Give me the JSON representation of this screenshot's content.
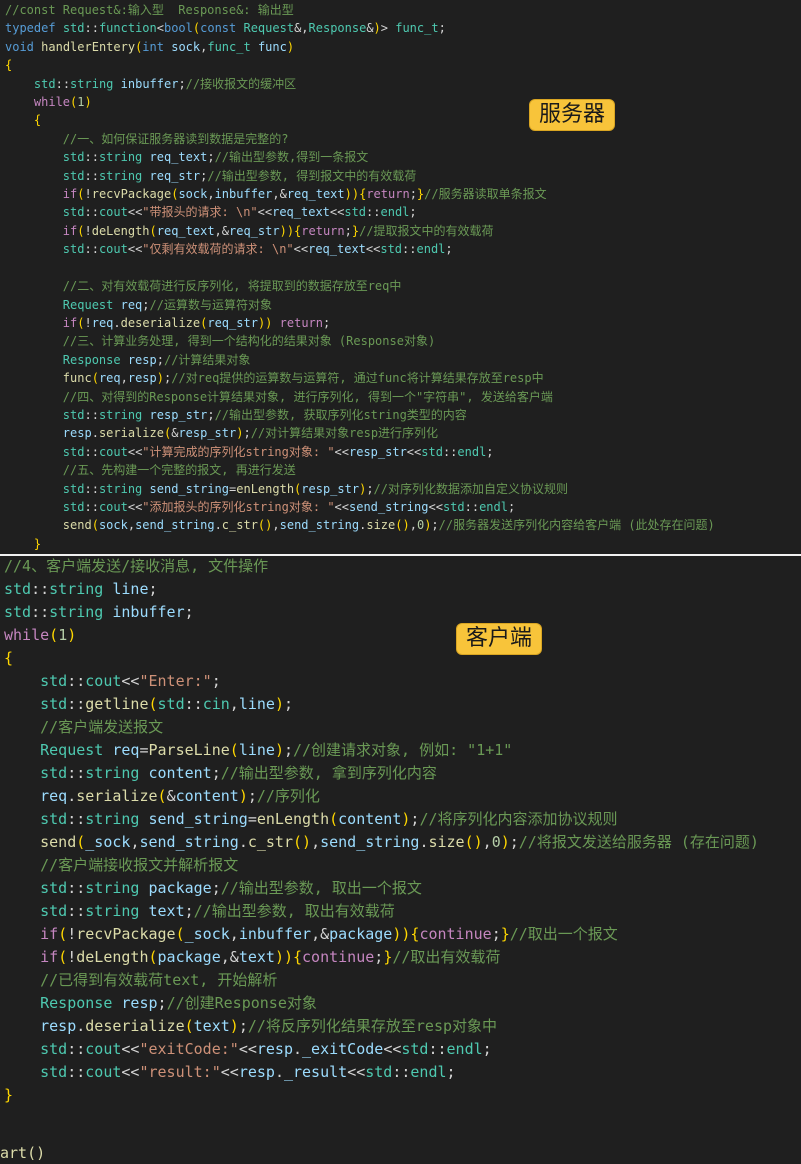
{
  "server": {
    "label": "服务器",
    "lines": [
      "//const Request&:输入型  Response&: 输出型",
      "typedef std::function<bool(const Request&,Response&)> func_t;",
      "void handlerEntery(int sock,func_t func)",
      "{",
      "    std::string inbuffer;//接收报文的缓冲区",
      "    while(1)",
      "    {",
      "        //一、如何保证服务器读到数据是完整的?",
      "        std::string req_text;//输出型参数,得到一条报文",
      "        std::string req_str;//输出型参数, 得到报文中的有效载荷",
      "        if(!recvPackage(sock,inbuffer,&req_text)){return;}//服务器读取单条报文",
      "        std::cout<<\"带报头的请求: \\n\"<<req_text<<std::endl;",
      "        if(!deLength(req_text,&req_str)){return;}//提取报文中的有效载荷",
      "        std::cout<<\"仅剩有效载荷的请求: \\n\"<<req_text<<std::endl;",
      "",
      "        //二、对有效载荷进行反序列化, 将提取到的数据存放至req中",
      "        Request req;//运算数与运算符对象",
      "        if(!req.deserialize(req_str)) return;",
      "        //三、计算业务处理, 得到一个结构化的结果对象 (Response对象)",
      "        Response resp;//计算结果对象",
      "        func(req,resp);//对req提供的运算数与运算符, 通过func将计算结果存放至resp中",
      "        //四、对得到的Response计算结果对象, 进行序列化, 得到一个\"字符串\", 发送给客户端",
      "        std::string resp_str;//输出型参数, 获取序列化string类型的内容",
      "        resp.serialize(&resp_str);//对计算结果对象resp进行序列化",
      "        std::cout<<\"计算完成的序列化string对象: \"<<resp_str<<std::endl;",
      "        //五、先构建一个完整的报文, 再进行发送",
      "        std::string send_string=enLength(resp_str);//对序列化数据添加自定义协议规则",
      "        std::cout<<\"添加报头的序列化string对象: \"<<send_string<<std::endl;",
      "        send(sock,send_string.c_str(),send_string.size(),0);//服务器发送序列化内容给客户端 (此处存在问题)",
      "    }"
    ]
  },
  "client": {
    "label": "客户端",
    "lines": [
      "//4、客户端发送/接收消息, 文件操作",
      "std::string line;",
      "std::string inbuffer;",
      "while(1)",
      "{",
      "    std::cout<<\"Enter:\";",
      "    std::getline(std::cin,line);",
      "    //客户端发送报文",
      "    Request req=ParseLine(line);//创建请求对象, 例如: \"1+1\"",
      "    std::string content;//输出型参数, 拿到序列化内容",
      "    req.serialize(&content);//序列化",
      "    std::string send_string=enLength(content);//将序列化内容添加协议规则",
      "    send(_sock,send_string.c_str(),send_string.size(),0);//将报文发送给服务器 (存在问题)",
      "    //客户端接收报文并解析报文",
      "    std::string package;//输出型参数, 取出一个报文",
      "    std::string text;//输出型参数, 取出有效载荷",
      "    if(!recvPackage(_sock,inbuffer,&package)){continue;}//取出一个报文",
      "    if(!deLength(package,&text)){continue;}//取出有效载荷",
      "    //已得到有效载荷text, 开始解析",
      "    Response resp;//创建Response对象",
      "    resp.deserialize(text);//将反序列化结果存放至resp对象中",
      "    std::cout<<\"exitCode:\"<<resp._exitCode<<std::endl;",
      "    std::cout<<\"result:\"<<resp._result<<std::endl;",
      "}"
    ],
    "trailing_fragment": "art()"
  },
  "colors": {
    "background": "#1f1f1f",
    "keyword": "#569cd6",
    "comment": "#6a9955",
    "string": "#ce9178",
    "type": "#4ec9b0",
    "function": "#dcdcaa",
    "variable": "#9cdcfe",
    "label_bg": "#f8c43a"
  }
}
